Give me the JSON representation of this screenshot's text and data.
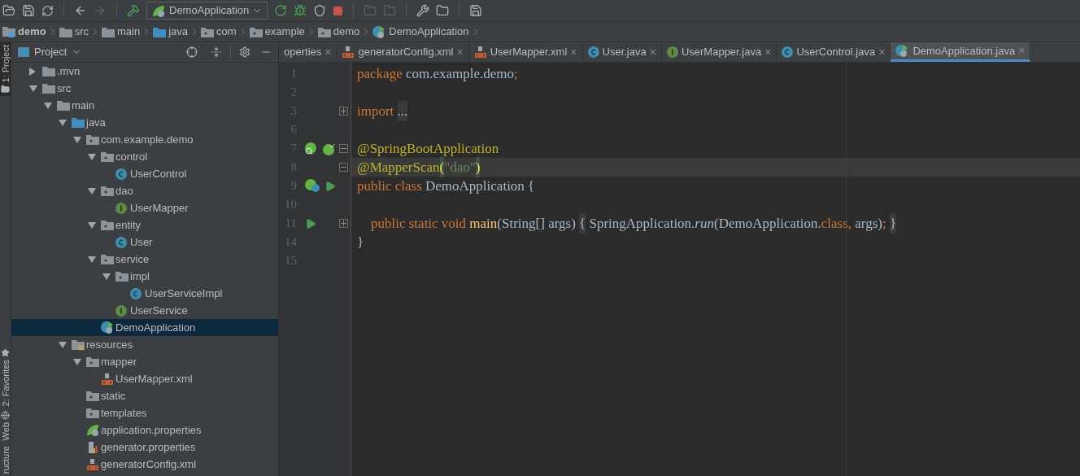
{
  "toolbar": {
    "run_config": "DemoApplication"
  },
  "breadcrumbs": [
    {
      "label": "demo",
      "kind": "module"
    },
    {
      "label": "src",
      "kind": "folder"
    },
    {
      "label": "main",
      "kind": "folder"
    },
    {
      "label": "java",
      "kind": "source"
    },
    {
      "label": "com",
      "kind": "package"
    },
    {
      "label": "example",
      "kind": "package"
    },
    {
      "label": "demo",
      "kind": "package"
    },
    {
      "label": "DemoApplication",
      "kind": "spring"
    }
  ],
  "side_stripe": [
    {
      "label": "1: Project",
      "kind": "folder",
      "selected": true
    },
    {
      "label": "2: Favorites",
      "kind": "star",
      "selected": false
    },
    {
      "label": "Web",
      "kind": "globe",
      "selected": false
    },
    {
      "label": "ructure",
      "kind": "none",
      "selected": false
    }
  ],
  "project_panel": {
    "title": "Project",
    "tree": [
      {
        "label": ".mvn",
        "kind": "folder",
        "expanded": false,
        "selected": false
      },
      {
        "label": "src",
        "kind": "folder",
        "expanded": true,
        "selected": false,
        "children": [
          {
            "label": "main",
            "kind": "folder",
            "expanded": true,
            "selected": false,
            "children": [
              {
                "label": "java",
                "kind": "source",
                "expanded": true,
                "selected": false,
                "children": [
                  {
                    "label": "com.example.demo",
                    "kind": "package",
                    "expanded": true,
                    "selected": false,
                    "children": [
                      {
                        "label": "control",
                        "kind": "package",
                        "expanded": true,
                        "selected": false,
                        "children": [
                          {
                            "label": "UserControl",
                            "kind": "class",
                            "selected": false
                          }
                        ]
                      },
                      {
                        "label": "dao",
                        "kind": "package",
                        "expanded": true,
                        "selected": false,
                        "children": [
                          {
                            "label": "UserMapper",
                            "kind": "interface",
                            "selected": false
                          }
                        ]
                      },
                      {
                        "label": "entity",
                        "kind": "package",
                        "expanded": true,
                        "selected": false,
                        "children": [
                          {
                            "label": "User",
                            "kind": "class",
                            "selected": false
                          }
                        ]
                      },
                      {
                        "label": "service",
                        "kind": "package",
                        "expanded": true,
                        "selected": false,
                        "children": [
                          {
                            "label": "impl",
                            "kind": "package",
                            "expanded": true,
                            "selected": false,
                            "children": [
                              {
                                "label": "UserServiceImpl",
                                "kind": "class",
                                "selected": false
                              }
                            ]
                          },
                          {
                            "label": "UserService",
                            "kind": "interface",
                            "selected": false
                          }
                        ]
                      },
                      {
                        "label": "DemoApplication",
                        "kind": "spring",
                        "selected": true
                      }
                    ]
                  }
                ]
              },
              {
                "label": "resources",
                "kind": "resources",
                "expanded": true,
                "selected": false,
                "children": [
                  {
                    "label": "mapper",
                    "kind": "package",
                    "expanded": true,
                    "selected": false,
                    "children": [
                      {
                        "label": "UserMapper.xml",
                        "kind": "xml",
                        "selected": false
                      }
                    ]
                  },
                  {
                    "label": "static",
                    "kind": "package",
                    "selected": false
                  },
                  {
                    "label": "templates",
                    "kind": "package",
                    "selected": false
                  },
                  {
                    "label": "application.properties",
                    "kind": "spring-props",
                    "selected": false
                  },
                  {
                    "label": "generator.properties",
                    "kind": "props",
                    "selected": false
                  },
                  {
                    "label": "generatorConfig.xml",
                    "kind": "xml",
                    "selected": false
                  }
                ]
              }
            ]
          }
        ]
      }
    ]
  },
  "tabs": [
    {
      "label": "operties",
      "kind": "none",
      "selected": false,
      "close": "×"
    },
    {
      "label": "generatorConfig.xml",
      "kind": "xml",
      "selected": false,
      "close": "×"
    },
    {
      "label": "UserMapper.xml",
      "kind": "xml",
      "selected": false,
      "close": "×"
    },
    {
      "label": "User.java",
      "kind": "class",
      "selected": false,
      "close": "×"
    },
    {
      "label": "UserMapper.java",
      "kind": "interface",
      "selected": false,
      "close": "×"
    },
    {
      "label": "UserControl.java",
      "kind": "class",
      "selected": false,
      "close": "×"
    },
    {
      "label": "DemoApplication.java",
      "kind": "spring",
      "selected": true,
      "close": "×"
    }
  ],
  "editor": {
    "lines": [
      {
        "number": "1",
        "current": false,
        "tokens": [
          {
            "text": "package ",
            "kind": "keyword"
          },
          {
            "text": "com.example.demo",
            "kind": "plain"
          },
          {
            "text": ";",
            "kind": "keyword"
          }
        ]
      },
      {
        "number": "2",
        "current": false
      },
      {
        "number": "3",
        "current": false,
        "fold": {
          "kind": "plus"
        },
        "tokens": [
          {
            "text": "import ",
            "kind": "keyword"
          },
          {
            "text": "...",
            "kind": "folded"
          }
        ]
      },
      {
        "number": "6",
        "current": false
      },
      {
        "number": "7",
        "current": false,
        "gutter": [
          {
            "kind": "bean-search"
          },
          {
            "kind": "bean-check"
          }
        ],
        "fold": {
          "kind": "minus"
        },
        "tokens": [
          {
            "text": "@SpringBootApplication",
            "kind": "annotation"
          }
        ]
      },
      {
        "number": "8",
        "current": true,
        "fold": {
          "kind": "minus"
        },
        "tokens": [
          {
            "text": "@MapperScan",
            "kind": "annotation"
          },
          {
            "text": "(",
            "kind": "brace-match"
          },
          {
            "text": "\"dao\"",
            "kind": "string"
          },
          {
            "text": ")",
            "kind": "brace-match"
          }
        ]
      },
      {
        "number": "9",
        "current": false,
        "gutter": [
          {
            "kind": "bean-class"
          },
          {
            "kind": "run"
          }
        ],
        "tokens": [
          {
            "text": "public class ",
            "kind": "keyword"
          },
          {
            "text": "DemoApplication {",
            "kind": "plain"
          }
        ]
      },
      {
        "number": "10",
        "current": false
      },
      {
        "number": "11",
        "current": false,
        "gutter": [
          {
            "kind": "run"
          }
        ],
        "fold": {
          "kind": "plus"
        },
        "tokens": [
          {
            "text": "    public static void ",
            "kind": "keyword"
          },
          {
            "text": "main",
            "kind": "method"
          },
          {
            "text": "(String[] args) ",
            "kind": "plain"
          },
          {
            "text": "{",
            "kind": "folded"
          },
          {
            "text": " SpringApplication.",
            "kind": "plain"
          },
          {
            "text": "run",
            "kind": "italic"
          },
          {
            "text": "(DemoApplication.",
            "kind": "plain"
          },
          {
            "text": "class, ",
            "kind": "keyword"
          },
          {
            "text": "args)",
            "kind": "plain"
          },
          {
            "text": "; ",
            "kind": "keyword"
          },
          {
            "text": "}",
            "kind": "folded"
          }
        ]
      },
      {
        "number": "14",
        "current": false,
        "tokens": [
          {
            "text": "}",
            "kind": "plain"
          }
        ]
      },
      {
        "number": "15",
        "current": false
      }
    ]
  }
}
